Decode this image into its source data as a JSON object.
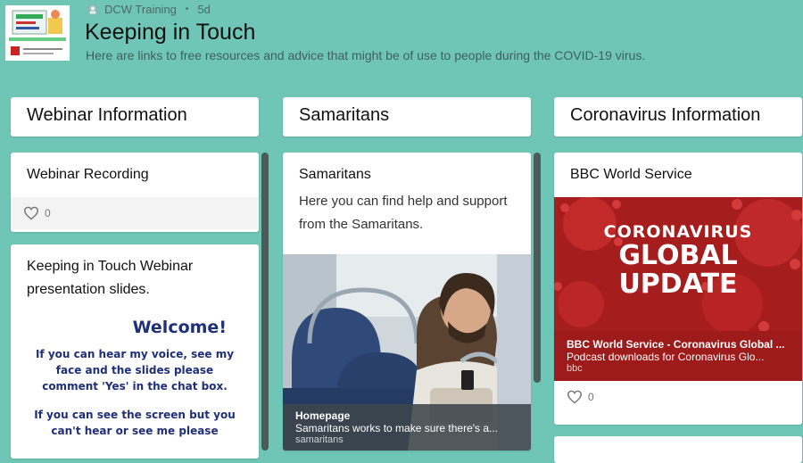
{
  "header": {
    "author": "DCW Training",
    "age": "5d",
    "title": "Keeping in Touch",
    "description": "Here are links to free resources and advice that might be of use to people during the COVID-19 virus."
  },
  "columns": [
    {
      "title": "Webinar Information",
      "cards": [
        {
          "title": "Webinar Recording",
          "likes": "0"
        },
        {
          "title": "Keeping in Touch Webinar presentation slides.",
          "slide": {
            "welcome": "Welcome!",
            "line1": "If you can hear my voice, see my face and the slides please comment 'Yes' in the chat box.",
            "line2": "If you can see the screen but you can't hear or see  me please"
          }
        }
      ]
    },
    {
      "title": "Samaritans",
      "cards": [
        {
          "title": "Samaritans",
          "body": "Here you can find help and support from the Samaritans.",
          "link": {
            "heading": "Homepage",
            "text": "Samaritans works to make sure there's a...",
            "source": "samaritans"
          }
        }
      ]
    },
    {
      "title": "Coronavirus Information",
      "cards": [
        {
          "title": "BBC World Service",
          "image_text": [
            "CORONAVIRUS",
            "GLOBAL",
            "UPDATE"
          ],
          "link": {
            "heading": "BBC World Service - Coronavirus Global ...",
            "text": "Podcast downloads for Coronavirus Glo...",
            "source": "bbc"
          },
          "likes": "0"
        }
      ]
    }
  ],
  "colors": {
    "background": "#6fc6b6",
    "scrollbar": "#4b5b59",
    "bbc_red": "#9e1b1b",
    "slide_blue": "#1f2f78"
  },
  "icons": {
    "like": "heart-icon",
    "author": "avatar-icon"
  }
}
